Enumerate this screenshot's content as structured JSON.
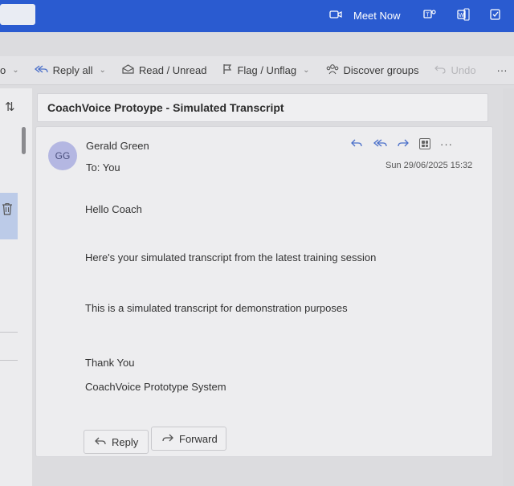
{
  "topbar": {
    "meet_now_label": "Meet Now",
    "icons": [
      "video-icon",
      "teams-icon",
      "word-icon",
      "todo-icon"
    ]
  },
  "toolbar": {
    "partial_label": "o",
    "reply_all_label": "Reply all",
    "read_unread_label": "Read / Unread",
    "flag_label": "Flag / Unflag",
    "discover_groups_label": "Discover groups",
    "undo_label": "Undo",
    "more_label": "···"
  },
  "message": {
    "subject": "CoachVoice Protoype - Simulated Transcript",
    "avatar_initials": "GG",
    "sender": "Gerald Green",
    "to": "To:  You",
    "date": "Sun 29/06/2025 15:32",
    "body": {
      "greeting": "Hello Coach",
      "line1": "Here's your simulated transcript from the latest training session",
      "line2": "This is a simulated transcript for demonstration purposes",
      "signoff": "Thank You",
      "signature": "CoachVoice Prototype System"
    },
    "reply_label": "Reply",
    "forward_label": "Forward",
    "more_label": "···"
  }
}
